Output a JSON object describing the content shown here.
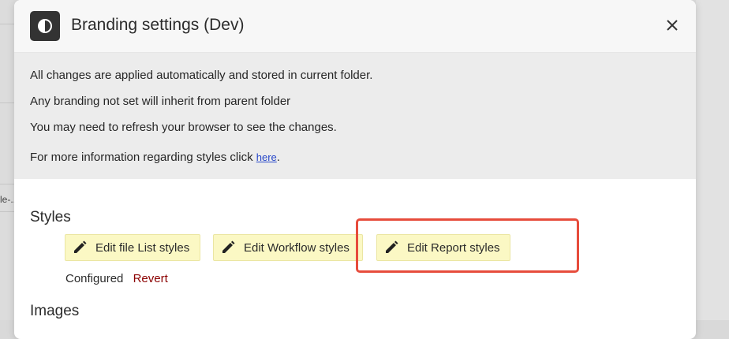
{
  "background": {
    "snippet": "le-.."
  },
  "dialog": {
    "title": "Branding settings (Dev)",
    "close_icon": "close-icon",
    "app_icon": "drop-icon"
  },
  "info": {
    "line1": "All changes are applied automatically and stored in current folder.",
    "line2": "Any branding not set will inherit from parent folder",
    "line3": "You may need to refresh your browser to see the changes.",
    "more_prefix": "For more information regarding styles click ",
    "more_link": "here",
    "more_suffix": "."
  },
  "styles": {
    "title": "Styles",
    "buttons": [
      {
        "label": "Edit file List styles",
        "icon": "pencil-icon"
      },
      {
        "label": "Edit Workflow styles",
        "icon": "pencil-icon"
      },
      {
        "label": "Edit Report styles",
        "icon": "pencil-icon"
      }
    ],
    "status": "Configured",
    "revert_label": "Revert"
  },
  "images": {
    "title": "Images"
  },
  "colors": {
    "button_bg": "#fbf8c4",
    "revert": "#8b0000",
    "highlight": "#e74c3c"
  }
}
